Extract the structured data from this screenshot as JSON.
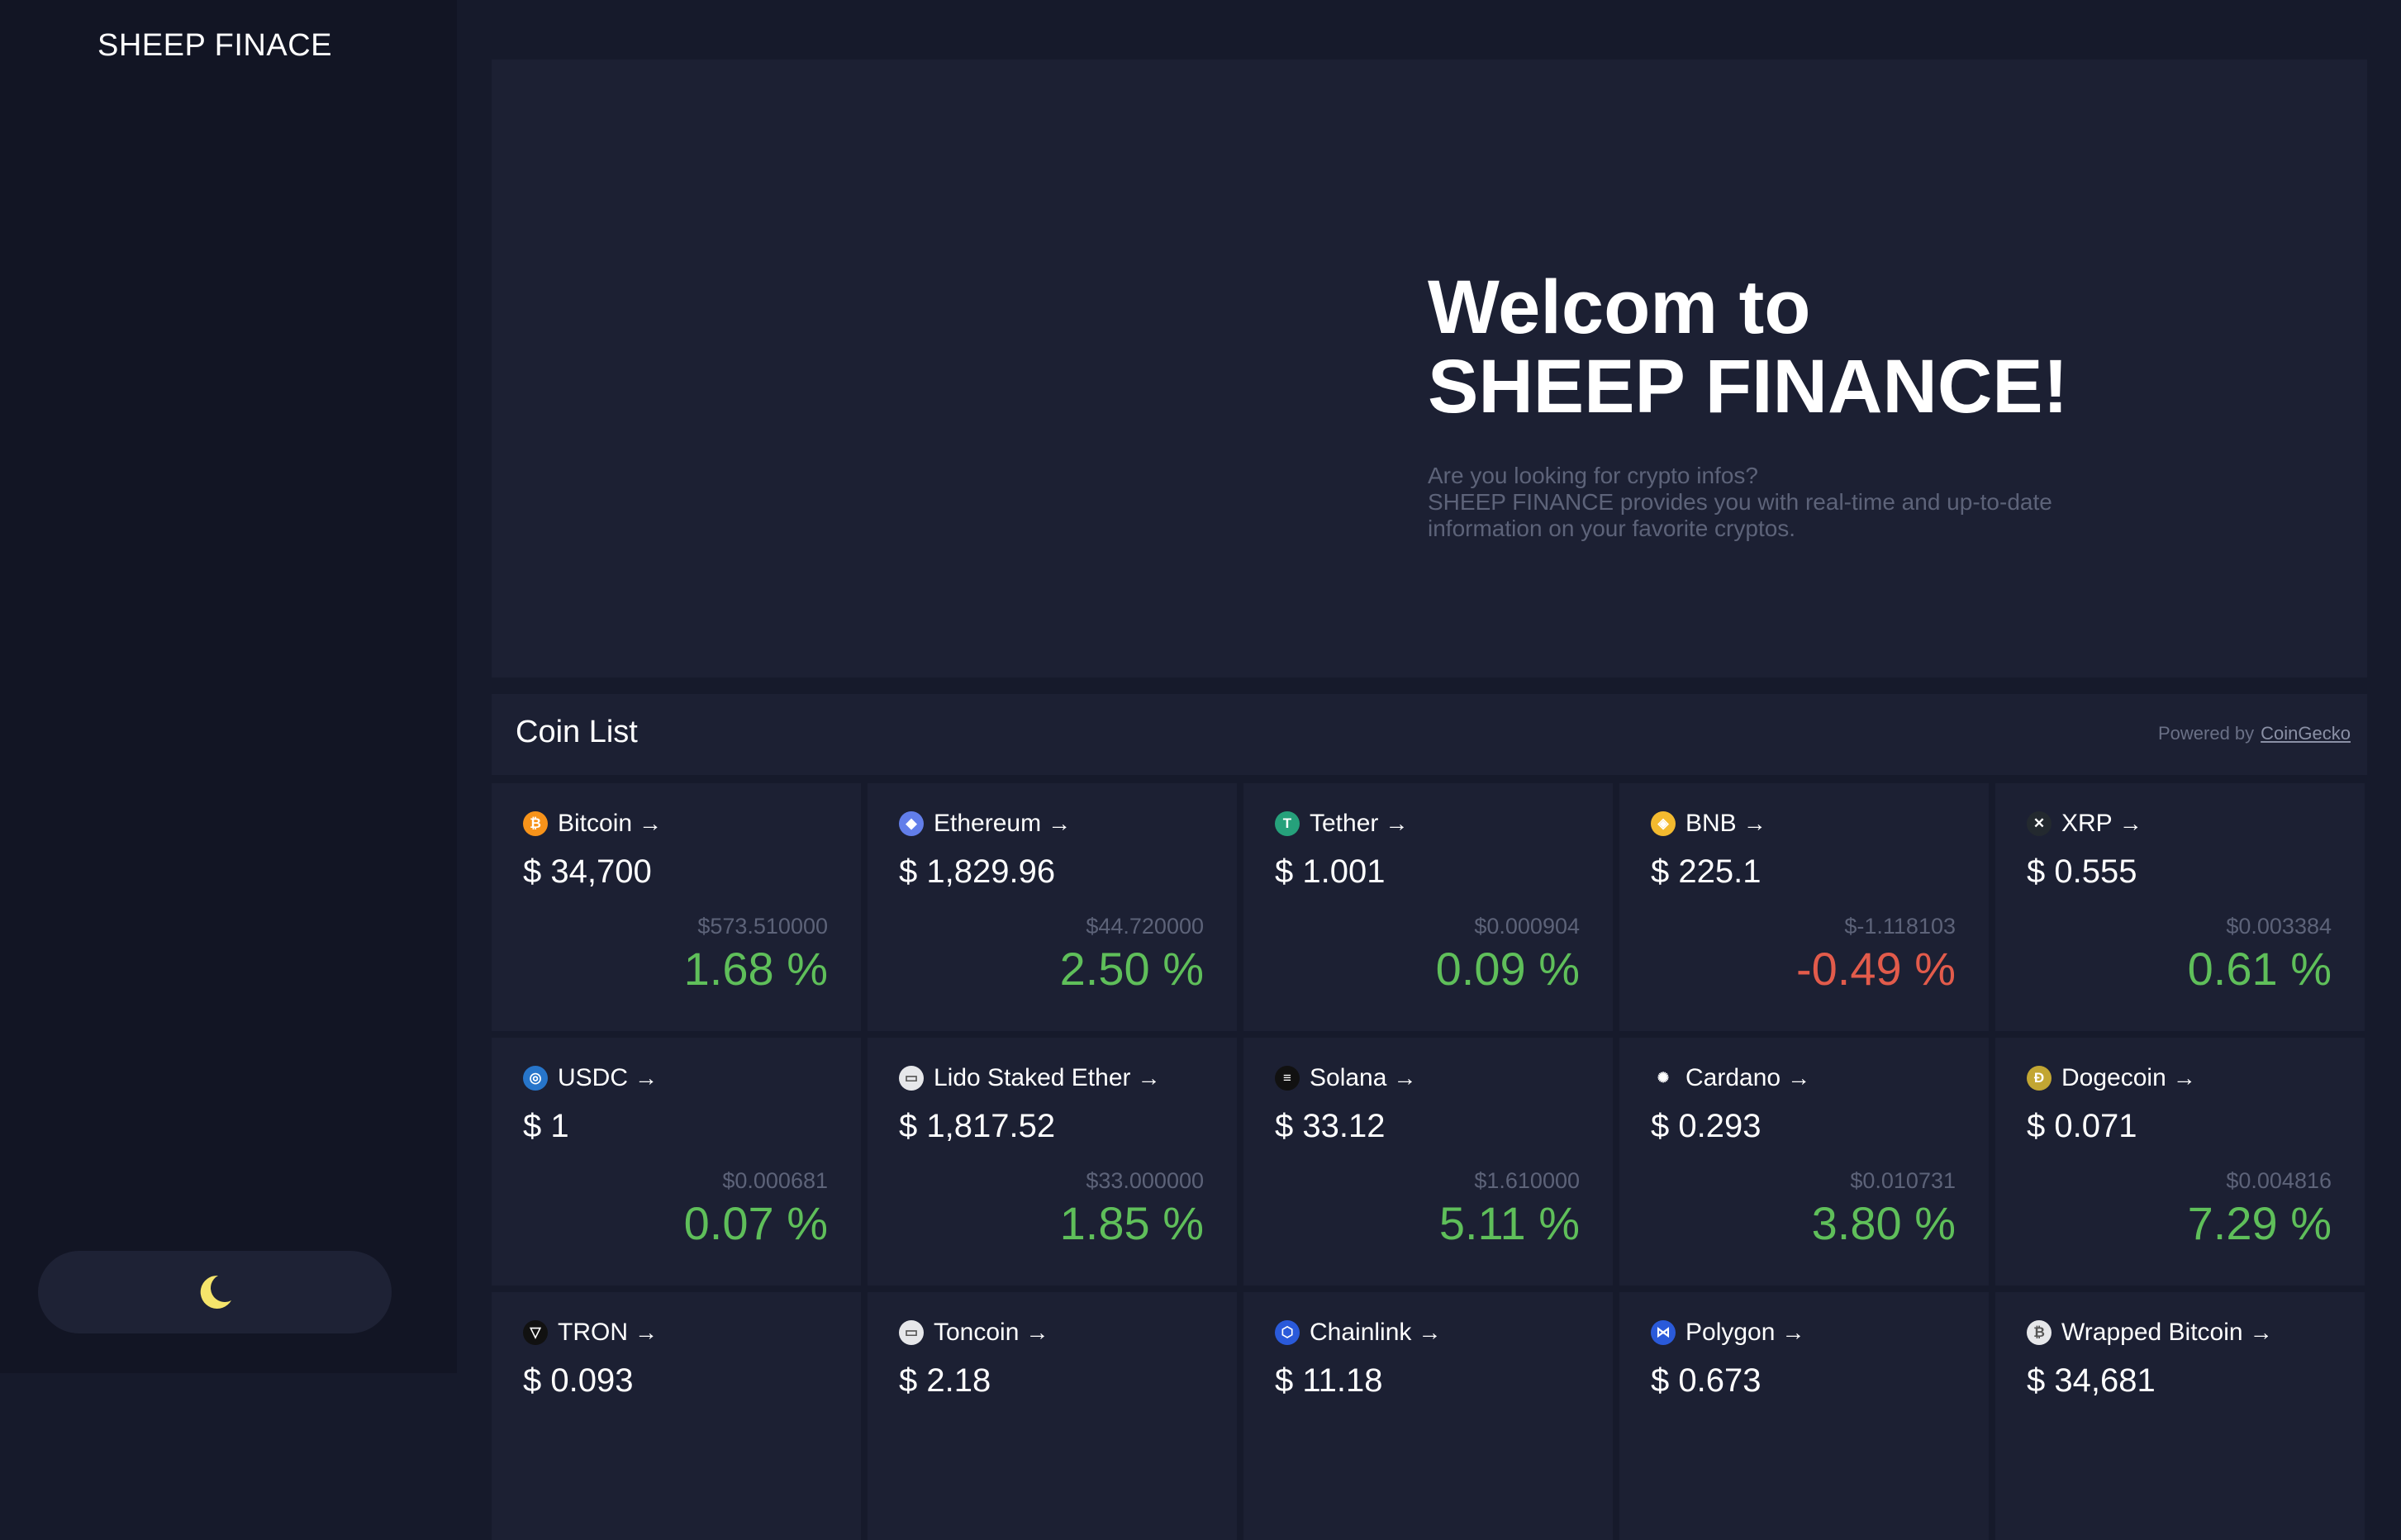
{
  "brand": "SHEEP FINACE",
  "hero": {
    "title_line1": "Welcom to",
    "title_line2": "SHEEP FINANCE!",
    "desc_line1": "Are you looking for crypto infos?",
    "desc_line2": "SHEEP FINANCE provides you with real-time and up-to-date information on your favorite cryptos."
  },
  "coin_list": {
    "title": "Coin List",
    "powered_by": "Powered by",
    "powered_link": "CoinGecko"
  },
  "arrow": "→",
  "coins": [
    {
      "name": "Bitcoin",
      "price": "$ 34,700",
      "change_abs": "$573.510000",
      "change_pct": "1.68 %",
      "icon": "bitcoin-icon",
      "icon_color": "#f7931a",
      "glyph": "₿"
    },
    {
      "name": "Ethereum",
      "price": "$ 1,829.96",
      "change_abs": "$44.720000",
      "change_pct": "2.50 %",
      "icon": "ethereum-icon",
      "icon_color": "#627eea",
      "glyph": "◆"
    },
    {
      "name": "Tether",
      "price": "$ 1.001",
      "change_abs": "$0.000904",
      "change_pct": "0.09 %",
      "icon": "tether-icon",
      "icon_color": "#26a17b",
      "glyph": "T"
    },
    {
      "name": "BNB",
      "price": "$ 225.1",
      "change_abs": "$-1.118103",
      "change_pct": "-0.49 %",
      "icon": "bnb-icon",
      "icon_color": "#f3ba2f",
      "glyph": "◈"
    },
    {
      "name": "XRP",
      "price": "$ 0.555",
      "change_abs": "$0.003384",
      "change_pct": "0.61 %",
      "icon": "xrp-icon",
      "icon_color": "#23292f",
      "glyph": "✕"
    },
    {
      "name": "USDC",
      "price": "$ 1",
      "change_abs": "$0.000681",
      "change_pct": "0.07 %",
      "icon": "usdc-icon",
      "icon_color": "#2775ca",
      "glyph": "◎"
    },
    {
      "name": "Lido Staked Ether",
      "price": "$ 1,817.52",
      "change_abs": "$33.000000",
      "change_pct": "1.85 %",
      "icon": "lido-staked-ether-icon",
      "icon_color": "#e6e7ea",
      "glyph": "▭"
    },
    {
      "name": "Solana",
      "price": "$ 33.12",
      "change_abs": "$1.610000",
      "change_pct": "5.11 %",
      "icon": "solana-icon",
      "icon_color": "#111111",
      "glyph": "≡"
    },
    {
      "name": "Cardano",
      "price": "$ 0.293",
      "change_abs": "$0.010731",
      "change_pct": "3.80 %",
      "icon": "cardano-icon",
      "icon_color": "#1c2033",
      "glyph": "✺"
    },
    {
      "name": "Dogecoin",
      "price": "$ 0.071",
      "change_abs": "$0.004816",
      "change_pct": "7.29 %",
      "icon": "dogecoin-icon",
      "icon_color": "#c2a633",
      "glyph": "Ð"
    },
    {
      "name": "TRON",
      "price": "$ 0.093",
      "change_abs": "",
      "change_pct": "",
      "icon": "tron-icon",
      "icon_color": "#111111",
      "glyph": "▽"
    },
    {
      "name": "Toncoin",
      "price": "$ 2.18",
      "change_abs": "",
      "change_pct": "",
      "icon": "toncoin-icon",
      "icon_color": "#e6e7ea",
      "glyph": "▭"
    },
    {
      "name": "Chainlink",
      "price": "$ 11.18",
      "change_abs": "",
      "change_pct": "",
      "icon": "chainlink-icon",
      "icon_color": "#2a5ada",
      "glyph": "⬡"
    },
    {
      "name": "Polygon",
      "price": "$ 0.673",
      "change_abs": "",
      "change_pct": "",
      "icon": "polygon-icon",
      "icon_color": "#2a5ada",
      "glyph": "⋈"
    },
    {
      "name": "Wrapped Bitcoin",
      "price": "$ 34,681",
      "change_abs": "",
      "change_pct": "",
      "icon": "wrapped-bitcoin-icon",
      "icon_color": "#e6e7ea",
      "glyph": "₿"
    }
  ]
}
